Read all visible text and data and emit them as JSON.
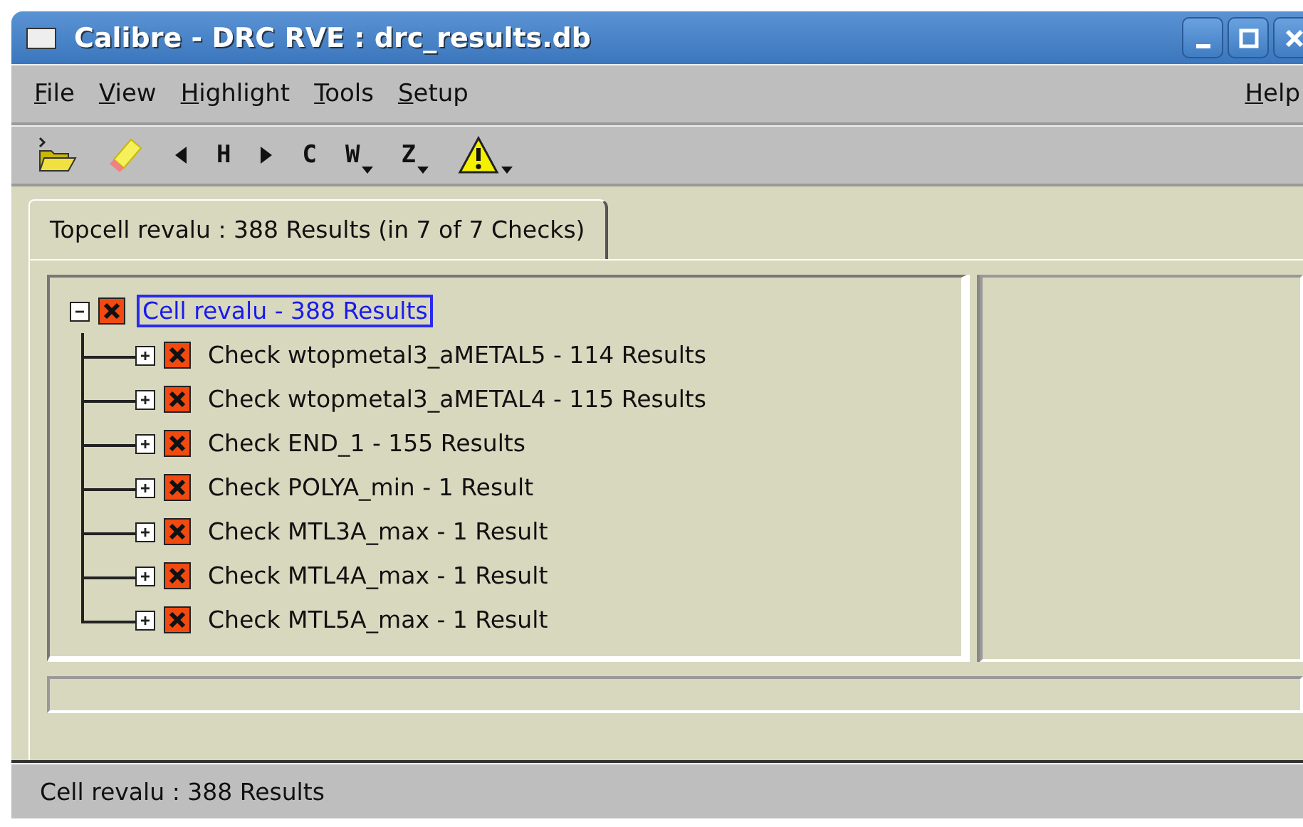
{
  "window": {
    "title": "Calibre - DRC RVE : drc_results.db"
  },
  "menus": [
    "File",
    "View",
    "Highlight",
    "Tools",
    "Setup"
  ],
  "help_menu": "Help",
  "toolbar": [
    {
      "kind": "open"
    },
    {
      "kind": "highlight"
    },
    {
      "kind": "prev"
    },
    {
      "kind": "letter",
      "label": "H",
      "dropdown": false
    },
    {
      "kind": "next"
    },
    {
      "kind": "letter",
      "label": "C",
      "dropdown": false
    },
    {
      "kind": "letter",
      "label": "W",
      "dropdown": true
    },
    {
      "kind": "letter",
      "label": "Z",
      "dropdown": true
    },
    {
      "kind": "warning",
      "dropdown": true
    }
  ],
  "tabs": [
    {
      "label": "Topcell revalu : 388 Results (in 7 of 7 Checks)",
      "selected": true
    }
  ],
  "tree": [
    {
      "label": "Cell revalu - 388 Results",
      "expanded": true,
      "selected": true,
      "children": [
        {
          "label": "Check wtopmetal3_aMETAL5 - 114 Results",
          "expanded": false,
          "selected": false
        },
        {
          "label": "Check wtopmetal3_aMETAL4 - 115 Results",
          "expanded": false,
          "selected": false
        },
        {
          "label": "Check END_1 - 155 Results",
          "expanded": false,
          "selected": false
        },
        {
          "label": "Check POLYA_min - 1 Result",
          "expanded": false,
          "selected": false
        },
        {
          "label": "Check MTL3A_max - 1 Result",
          "expanded": false,
          "selected": false
        },
        {
          "label": "Check MTL4A_max - 1 Result",
          "expanded": false,
          "selected": false
        },
        {
          "label": "Check MTL5A_max - 1 Result",
          "expanded": false,
          "selected": false
        }
      ]
    }
  ],
  "status_bar": "Cell revalu : 388 Results"
}
